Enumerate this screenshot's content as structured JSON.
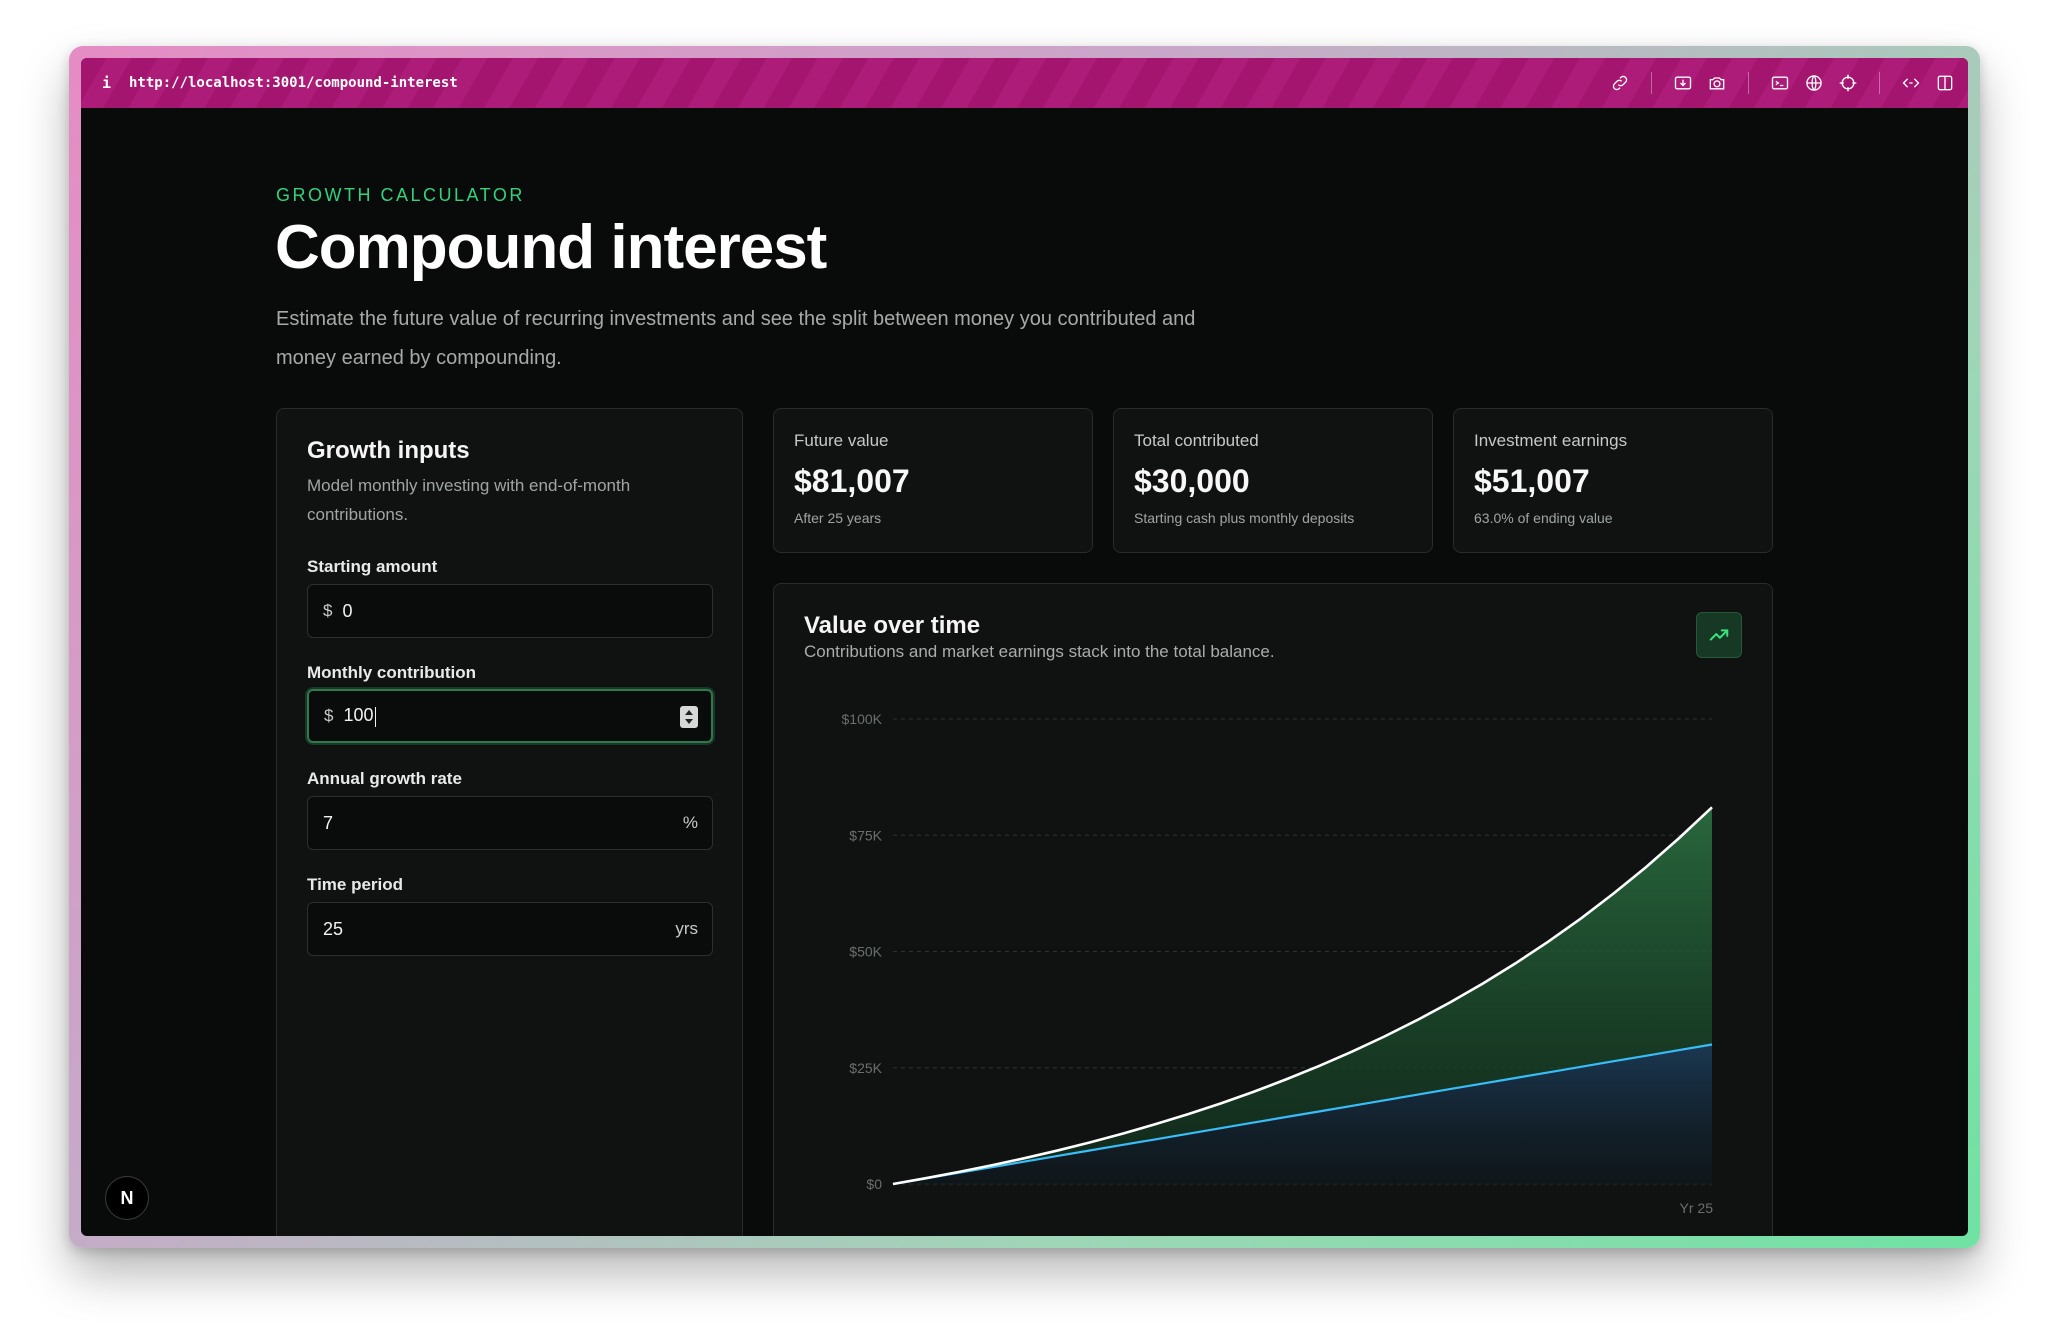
{
  "browser": {
    "info_icon": "i",
    "url": "http://localhost:3001/compound-interest",
    "toolbar_icons": [
      "link-icon",
      "image-download-icon",
      "camera-icon",
      "terminal-icon",
      "globe-icon",
      "crosshair-icon",
      "code-icon",
      "sidebar-icon"
    ]
  },
  "page": {
    "eyebrow": "GROWTH CALCULATOR",
    "title": "Compound interest",
    "description": "Estimate the future value of recurring investments and see the split between money you contributed and money earned by compounding."
  },
  "inputs": {
    "title": "Growth inputs",
    "subtitle": "Model monthly investing with end-of-month contributions.",
    "starting_amount": {
      "label": "Starting amount",
      "prefix": "$",
      "value": "0"
    },
    "monthly_contribution": {
      "label": "Monthly contribution",
      "prefix": "$",
      "value": "100"
    },
    "annual_growth_rate": {
      "label": "Annual growth rate",
      "value": "7",
      "suffix": "%"
    },
    "time_period": {
      "label": "Time period",
      "value": "25",
      "suffix": "yrs"
    }
  },
  "stats": [
    {
      "label": "Future value",
      "value": "$81,007",
      "note": "After 25 years"
    },
    {
      "label": "Total contributed",
      "value": "$30,000",
      "note": "Starting cash plus monthly deposits"
    },
    {
      "label": "Investment earnings",
      "value": "$51,007",
      "note": "63.0% of ending value"
    }
  ],
  "chart": {
    "title": "Value over time",
    "subtitle": "Contributions and market earnings stack into the total balance.",
    "icon": "trending-up-icon",
    "x_end_label": "Yr 25"
  },
  "chart_data": {
    "type": "area",
    "y_ticks": [
      "$0",
      "$25K",
      "$50K",
      "$75K",
      "$100K"
    ],
    "ylim": [
      0,
      100000
    ],
    "xlim": [
      0,
      25
    ],
    "x_label_end": "Yr 25",
    "grid": true,
    "series": [
      {
        "values": [
          0,
          1200,
          2400,
          3600,
          4800,
          6000,
          7200,
          8400,
          9600,
          10800,
          12000,
          13200,
          14400,
          15600,
          16800,
          18000,
          19200,
          20400,
          21600,
          22800,
          24000,
          25200,
          26400,
          27600,
          28800,
          30000
        ],
        "color": "#38bdf8"
      },
      {
        "values": [
          0,
          1240,
          2570,
          3996,
          5525,
          7165,
          8923,
          10808,
          12829,
          14996,
          17320,
          19812,
          22484,
          25349,
          28421,
          31715,
          35247,
          39034,
          43095,
          47449,
          52118,
          57124,
          62492,
          68247,
          74419,
          81007
        ],
        "color": "#ffffff"
      }
    ],
    "colors": {
      "earnings_fill": "#2a6b3f",
      "contributions_fill": "#1b3a55"
    }
  },
  "badge": {
    "letter": "N"
  }
}
